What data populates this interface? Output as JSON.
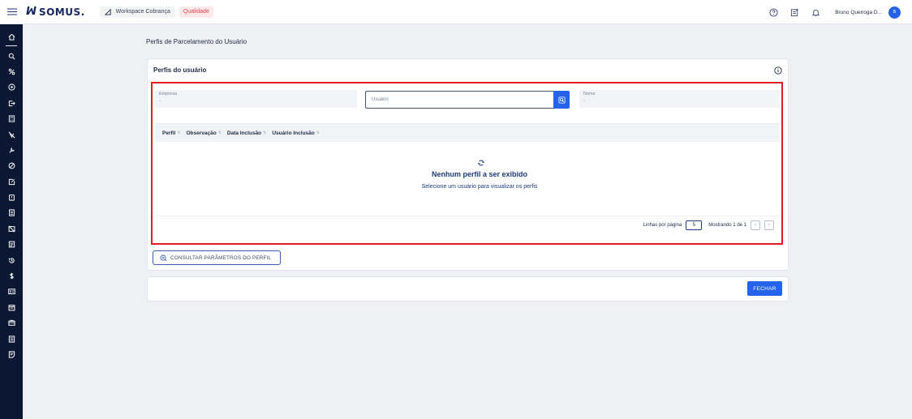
{
  "topbar": {
    "brand": "SOMUS.",
    "workspace": "Workspace Cobrança",
    "environment": "Qualidade",
    "user_name": "Bruno Queiroga D...",
    "avatar_initials": "B",
    "icons": [
      "help-icon",
      "notes-icon",
      "bell-icon"
    ]
  },
  "sidebar": {
    "icons": [
      "home-icon",
      "search-icon",
      "percent-icon",
      "coin-icon",
      "export-icon",
      "calculator-icon",
      "no-sign-icon",
      "tools-icon",
      "block-icon",
      "edit-doc-icon",
      "clipboard-icon",
      "document-icon",
      "no-image-icon",
      "list-doc-icon",
      "history-icon",
      "dollar-icon",
      "id-card-icon",
      "calendar-icon",
      "wallet-icon",
      "report-icon",
      "note-icon"
    ]
  },
  "page": {
    "title": "Perfis de Parcelamento do Usuário"
  },
  "card": {
    "title": "Perfis do usuário",
    "fields": {
      "empresa_label": "Empresa",
      "empresa_value": "-",
      "usuario_placeholder": "Usuário",
      "nome_label": "Nome",
      "nome_value": "-"
    },
    "table": {
      "columns": [
        "Perfil",
        "Observação",
        "Data Inclusão",
        "Usuário Inclusão"
      ],
      "rows": []
    },
    "empty": {
      "title": "Nenhum perfil a ser exibido",
      "subtitle": "Selecione um usuário para visualizar os perfis"
    },
    "pagination": {
      "rows_label": "Linhas por página",
      "rows_value": "5",
      "showing": "Mostrando 1 de 1"
    }
  },
  "actions": {
    "consult": "CONSULTAR PARÂMETROS DO PERFIL",
    "close": "FECHAR"
  },
  "colors": {
    "primary": "#2563eb",
    "sidebar": "#0b1733",
    "highlight": "#e01b24",
    "env_chip": "#e0424f"
  }
}
